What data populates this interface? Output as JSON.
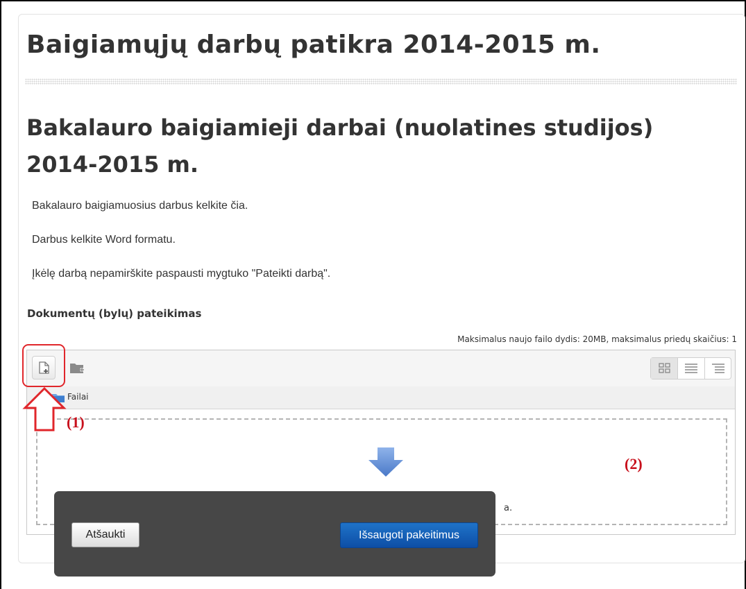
{
  "page": {
    "title": "Baigiamųjų darbų patikra 2014-2015 m.",
    "assignment_title": "Bakalauro baigiamieji darbai (nuolatines studijos) 2014-2015 m.",
    "instructions": [
      "Bakalauro baigiamuosius darbus kelkite čia.",
      "Darbus kelkite Word formatu.",
      "Įkėlę darbą nepamirškite paspausti mygtuko \"Pateikti darbą\"."
    ]
  },
  "submission": {
    "section_label": "Dokumentų (bylų) pateikimas",
    "limits": "Maksimalus naujo failo dydis: 20MB, maksimalus priedų skaičius: 1",
    "toolbar": {
      "add_file_icon": "add-file-icon",
      "create_folder_icon": "create-folder-icon",
      "views": [
        "grid-view-icon",
        "list-view-icon",
        "tree-view-icon"
      ],
      "active_view": "grid-view-icon"
    },
    "path": {
      "folder_icon": "folder-icon",
      "label": "Failai"
    },
    "dropzone": {
      "arrow_icon": "download-arrow-icon",
      "text_visible": "a."
    }
  },
  "annotations": {
    "marker_1": "(1)",
    "marker_2": "(2)"
  },
  "dialog": {
    "cancel_label": "Atšaukti",
    "save_label": "Išsaugoti pakeitimus"
  },
  "colors": {
    "annotation_red": "#e0262b",
    "save_button": "#1a6cc2",
    "dialog_background": "#474747",
    "drop_arrow": "#5b8ad4"
  }
}
